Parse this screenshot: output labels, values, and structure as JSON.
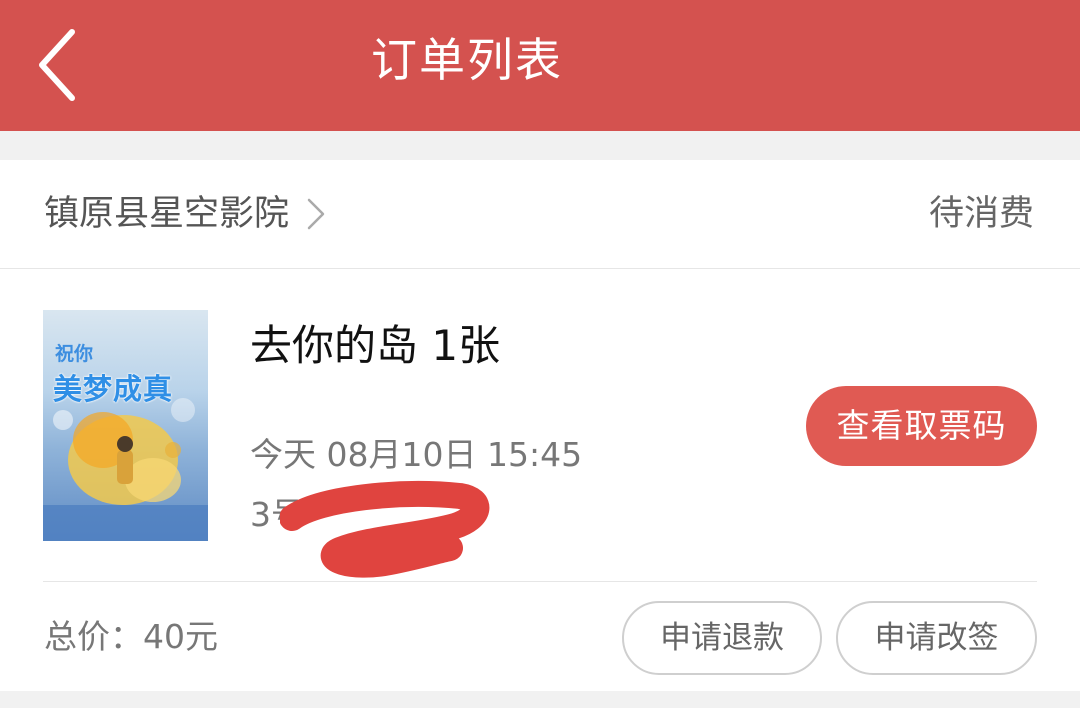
{
  "header": {
    "title": "订单列表",
    "back_icon": "chevron-left-icon",
    "background": "#d4524f"
  },
  "order": {
    "cinema_name": "镇原县星空影院",
    "status": "待消费",
    "movie_title": "去你的岛 1张",
    "showtime": "今天 08月10日 15:45",
    "hall": "3号",
    "poster": {
      "line1": "祝你",
      "line2": "美梦成真"
    },
    "view_ticket_label": "查看取票码",
    "total_price": "总价：40元",
    "refund_label": "申请退款",
    "change_label": "申请改签",
    "accent": "#e05a53"
  }
}
